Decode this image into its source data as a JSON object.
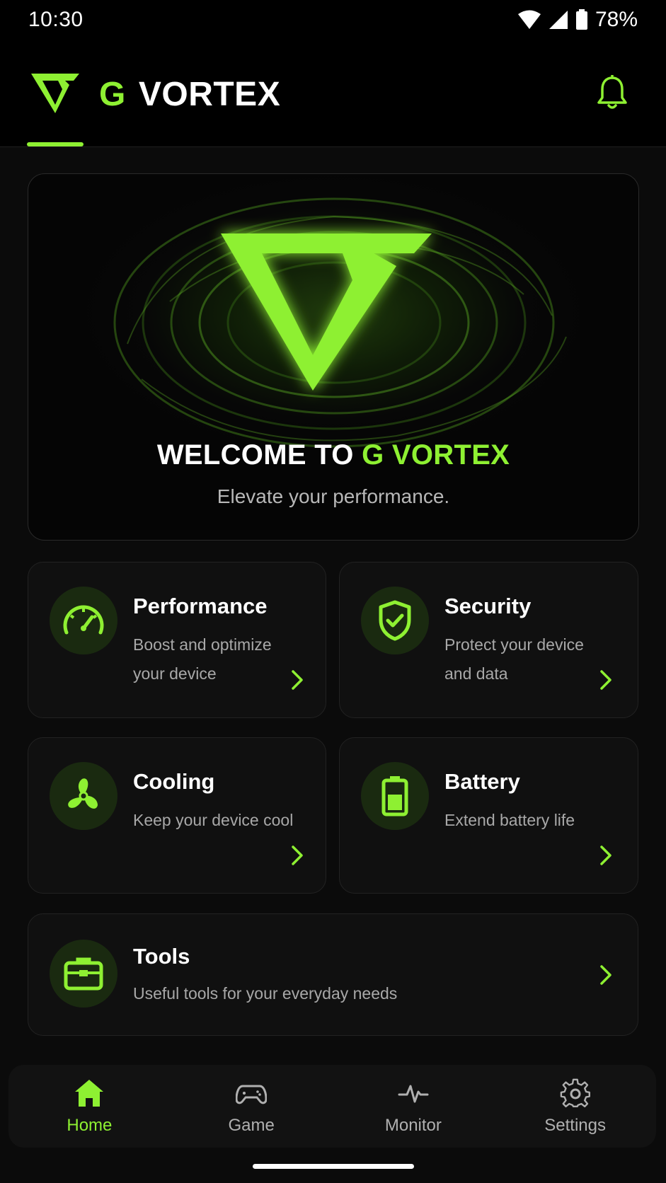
{
  "status_bar": {
    "time": "10:30",
    "battery": "78%"
  },
  "header": {
    "title_g": "G",
    "title_main": "VORTEX"
  },
  "hero": {
    "title_main": "WELCOME TO",
    "title_accent": "G VORTEX",
    "subtitle": "Elevate your performance."
  },
  "cards": [
    {
      "title": "Performance",
      "desc": "Boost and optimize your device",
      "icon": "speedometer-icon"
    },
    {
      "title": "Security",
      "desc": "Protect your device and data",
      "icon": "shield-check-icon"
    },
    {
      "title": "Cooling",
      "desc": "Keep your device cool",
      "icon": "fan-icon"
    },
    {
      "title": "Battery",
      "desc": "Extend battery life",
      "icon": "battery-icon"
    },
    {
      "title": "Tools",
      "desc": "Useful tools for your everyday needs",
      "icon": "toolbox-icon"
    }
  ],
  "nav": [
    {
      "label": "Home",
      "icon": "home-icon",
      "active": true
    },
    {
      "label": "Game",
      "icon": "gamepad-icon",
      "active": false
    },
    {
      "label": "Monitor",
      "icon": "pulse-icon",
      "active": false
    },
    {
      "label": "Settings",
      "icon": "gear-icon",
      "active": false
    }
  ],
  "colors": {
    "accent": "#8ef032",
    "background": "#0b0b0b",
    "card": "#101010"
  }
}
